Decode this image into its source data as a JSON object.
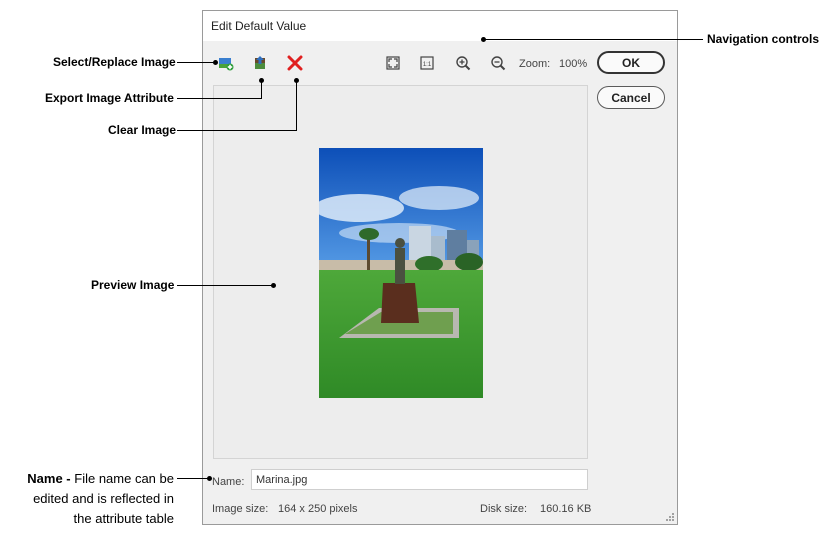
{
  "dialog": {
    "title": "Edit Default Value",
    "zoom_label": "Zoom:",
    "zoom_value": "100%",
    "ok_label": "OK",
    "cancel_label": "Cancel",
    "name_label": "Name:",
    "name_value": "Marina.jpg",
    "image_size_label": "Image size:",
    "image_size_value": "164 x 250 pixels",
    "disk_size_label": "Disk size:",
    "disk_size_value": "160.16 KB",
    "icons": [
      "select-replace-image-icon",
      "export-image-icon",
      "clear-image-icon",
      "fit-to-window-icon",
      "actual-size-icon",
      "zoom-in-icon",
      "zoom-out-icon"
    ],
    "colors": {
      "clear_icon": "#e02020",
      "sky": "#1e6fd0",
      "grass": "#3f9a2f"
    }
  },
  "callouts": {
    "select_replace": "Select/Replace Image",
    "export": "Export Image Attribute",
    "clear": "Clear Image",
    "preview": "Preview Image",
    "navigation": "Navigation controls",
    "name_bold": "Name -",
    "name_line1": "File name can be",
    "name_line2": "edited and is reflected in",
    "name_line3": "the attribute table"
  }
}
